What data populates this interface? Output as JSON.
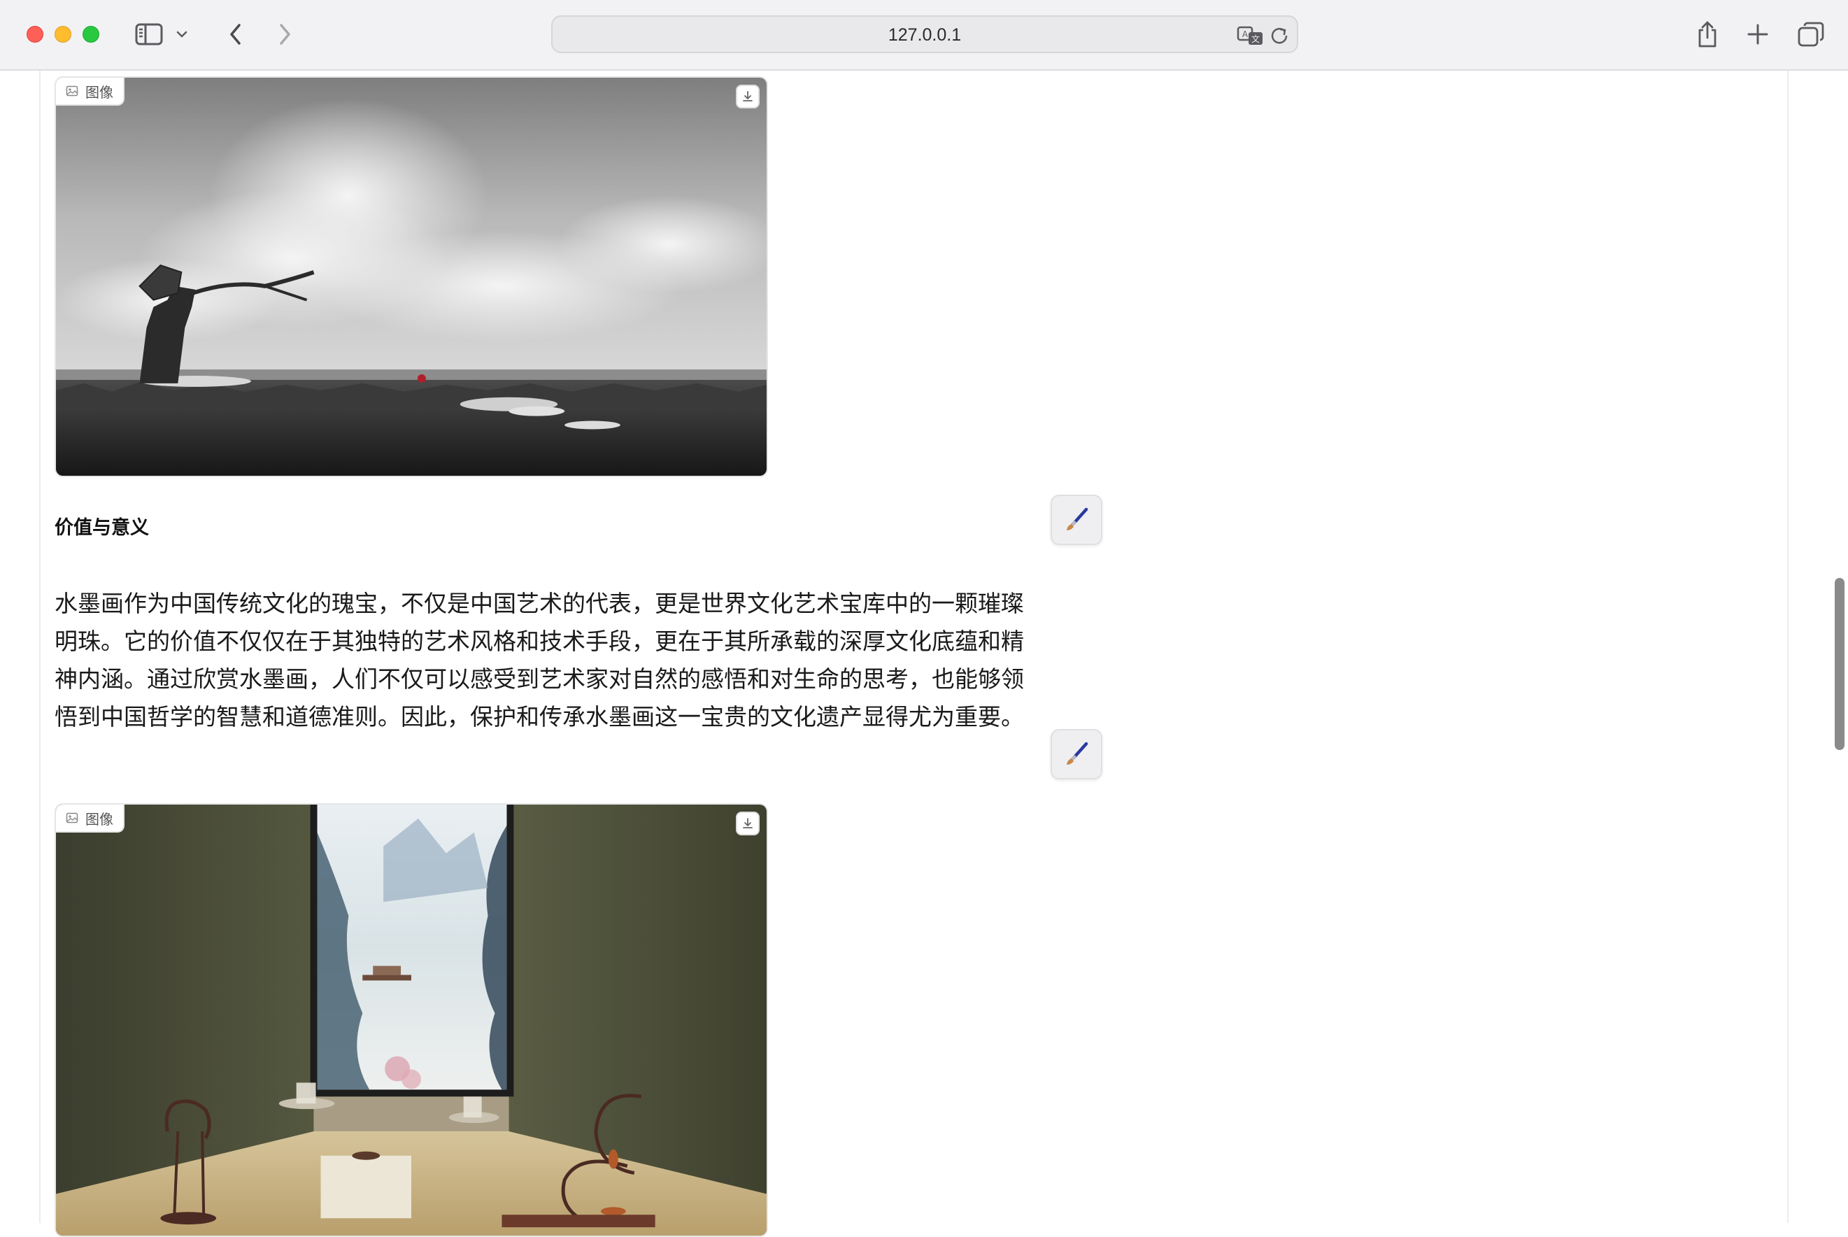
{
  "browser": {
    "url": "127.0.0.1"
  },
  "article": {
    "image1": {
      "label": "图像"
    },
    "section_heading": "价值与意义",
    "paragraph": "水墨画作为中国传统文化的瑰宝，不仅是中国艺术的代表，更是世界文化艺术宝库中的一颗璀璨明珠。它的价值不仅仅在于其独特的艺术风格和技术手段，更在于其所承载的深厚文化底蕴和精神内涵。通过欣赏水墨画，人们不仅可以感受到艺术家对自然的感悟和对生命的思考，也能够领悟到中国哲学的智慧和道德准则。因此，保护和传承水墨画这一宝贵的文化遗产显得尤为重要。",
    "image2": {
      "label": "图像"
    }
  },
  "colors": {
    "close": "#fe5f57",
    "minimize": "#febc2e",
    "zoom": "#28c840"
  }
}
